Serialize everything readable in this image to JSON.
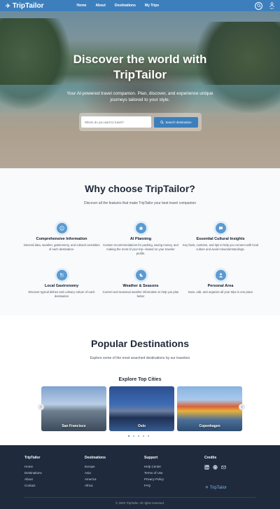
{
  "nav": {
    "brand": "TripTailor",
    "links": [
      "Home",
      "About",
      "Destinations",
      "My Trips"
    ],
    "user_label": "EN"
  },
  "hero": {
    "title_line1": "Discover the world with",
    "title_line2": "TripTailor",
    "subtitle": "Your AI-powered travel companion. Plan, discover, and experience unique journeys tailored to your style.",
    "search_placeholder": "Where do you want to travel?",
    "search_button": "Search destination"
  },
  "why": {
    "title": "Why choose TripTailor?",
    "subtitle": "Discover all the features that make TripTailor your best travel companion",
    "features": [
      {
        "icon": "info-icon",
        "title": "Comprehensive Information",
        "desc": "General data, weather, gastronomy, and cultural curiosities of each destination."
      },
      {
        "icon": "robot-icon",
        "title": "AI Planning",
        "desc": "Custom recommendations for packing, saving money, and making the most of your trip—based on your traveler profile."
      },
      {
        "icon": "chat-icon",
        "title": "Essential Cultural Insights",
        "desc": "Key facts, customs, and tips to help you connect with local culture and avoid misunderstandings."
      },
      {
        "icon": "food-icon",
        "title": "Local Gastronomy",
        "desc": "Discover typical dishes and culinary culture of each destination"
      },
      {
        "icon": "weather-icon",
        "title": "Weather & Seasons",
        "desc": "Current and seasonal weather information to help you plan better"
      },
      {
        "icon": "person-icon",
        "title": "Personal Area",
        "desc": "Save, edit, and organize all your trips in one place"
      }
    ]
  },
  "popular": {
    "title": "Popular Destinations",
    "subtitle": "Explore some of the most searched destinations by our travelers",
    "carousel_title": "Explore Top Cities",
    "cities": [
      "San Francisco",
      "Oslo",
      "Copenhagen"
    ],
    "dots": 5,
    "active_dot": 0
  },
  "footer": {
    "columns": [
      {
        "title": "TripTailor",
        "links": [
          "Home",
          "Destinations",
          "About",
          "Contact"
        ]
      },
      {
        "title": "Destinations",
        "links": [
          "Europe",
          "Asia",
          "America",
          "Africa"
        ]
      },
      {
        "title": "Support",
        "links": [
          "Help Center",
          "Terms of Use",
          "Privacy Policy",
          "FAQ"
        ]
      }
    ],
    "credits_title": "Credits",
    "brand": "TripTailor",
    "copyright": "© 2025 TripTailor. All rights reserved."
  }
}
